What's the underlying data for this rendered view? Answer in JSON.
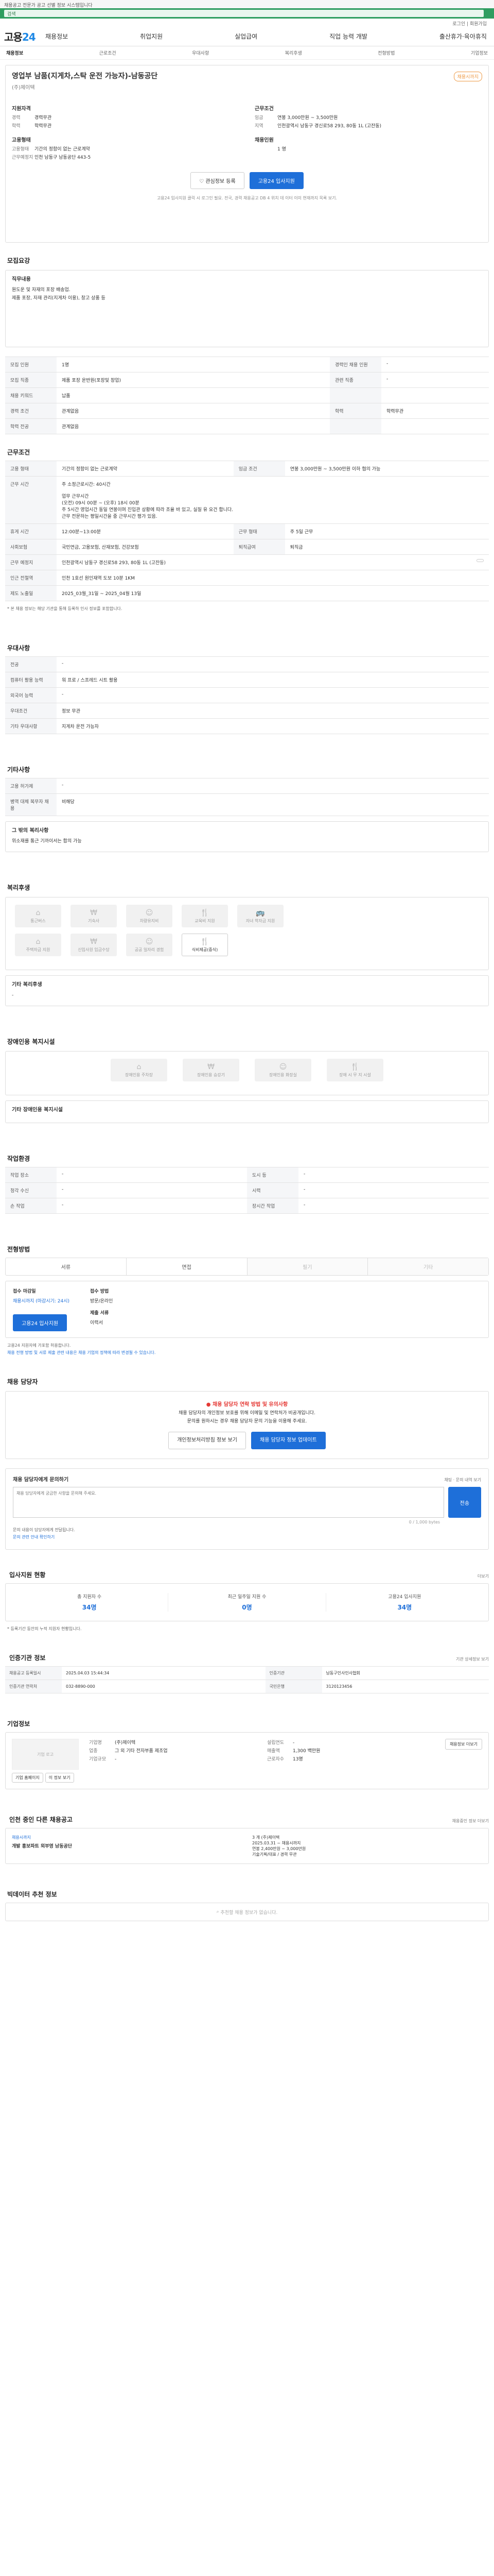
{
  "top": {
    "notice": "채용공고 전문가 공고 선별 정보 시스템입니다",
    "greenbar": "검색",
    "login": "로그인 | 회원가입"
  },
  "gnb": {
    "logo_a": "고용",
    "logo_b": "24",
    "menus": [
      "채용정보",
      "취업지원",
      "실업급여",
      "직업 능력 개발",
      "출산휴가·육아휴직"
    ]
  },
  "subnav": [
    "채용정보",
    "근로조건",
    "우대사항",
    "복리후생",
    "전형방법",
    "기업정보"
  ],
  "summary": {
    "title": "영업부 남품(지게차,스탁 운전 가능자)-남동공단",
    "company": "(주)제이텍",
    "badge": "채용시까지",
    "qual_head": "지원자격",
    "qual": [
      [
        "경력",
        "경력무관"
      ],
      [
        "학력",
        "학력무관"
      ]
    ],
    "work_head": "고용형태",
    "work": [
      [
        "고용형태",
        "기간의 정함이 없는 근로계약"
      ],
      [
        "근무예정지",
        "인천 남동구 남동공단 443-5"
      ]
    ],
    "cond_head": "근무조건",
    "cond": [
      [
        "임금",
        "연봉 3,000만원 ~ 3,500만원"
      ],
      [
        "지역",
        "인천광역시 남동구 경신로58 293, 80동 1L (고잔동)"
      ]
    ],
    "cond2_head": "채용인원",
    "cond2": [
      [
        "",
        "1 명"
      ]
    ],
    "buttons": {
      "save": "관심정보 등록",
      "apply": "고용24 입사지원"
    },
    "note": "고용24 입사지원 클릭 시 로그인 필요. 전국, 경력 채용공고 DB 4 위치 데 이터 이미 현재까지 목록 보기."
  },
  "recruit": {
    "title": "모집요강",
    "label": "직무내용",
    "lines": [
      "원도운 및 자재의 포장 배송업.",
      "제품 포장, 자재 관리(지게차 이용), 창고 상품 등"
    ]
  },
  "recruit_table": [
    [
      [
        "모집 인원",
        "1명"
      ],
      [
        "경력인 채용 인원",
        "-"
      ]
    ],
    [
      [
        "모집 직종",
        "제품 포장 운반원(포장및 창업)"
      ],
      [
        "관련 직종",
        "-"
      ]
    ],
    [
      [
        "채용 키워드",
        "납품"
      ],
      [
        "",
        ""
      ]
    ],
    [
      [
        "경력 조건",
        "관계없음"
      ],
      [
        "학력",
        "학력무관"
      ]
    ],
    [
      [
        "학력 전공",
        "관계없음"
      ],
      [
        "",
        ""
      ]
    ]
  ],
  "condition": {
    "title": "근무조건",
    "rows": [
      [
        "고용 형태",
        "기간의 정함이 없는 근로계약",
        "임금 조건",
        "연봉 3,000만원 ~ 3,500만원 이하 협의 가능"
      ],
      [
        "근무 시간",
        "주 소정근로시간: 40시간\n\n업무 근무시간\n(오전) 09시 00분 ~ (오후) 18시 00분\n주 5시간 영업시간 동일 연봉이며 진입관 상황에 따라 조율 바 있고, 실질 유 요건 합니다.\n근무 전문하는 평일시간을 중 근무시간 평가 있음.",
        "",
        ""
      ],
      [
        "휴게 시간",
        "12:00분~13:00분",
        "근무 형태",
        "주 5일 근무"
      ],
      [
        "사회보험",
        "국민연금, 고용보험, 산재보험, 건강보험",
        "퇴직급여",
        "퇴직금"
      ],
      [
        "근무 예정지",
        "인천광역시 남동구 경신로58 293, 80동 1L (고잔동)",
        "",
        ""
      ],
      [
        "인근 전철역",
        "인천 1호선 원인재역 도보 10분 1KM",
        "",
        ""
      ],
      [
        "제도 노출일",
        "2025_03월_31일 ~ 2025_04월 13일",
        "",
        ""
      ]
    ],
    "map_btn": "지도 보기",
    "foot": "* 본 채용 정보는 해당 기관을 통해 등록하 인사 정보를 포함합니다."
  },
  "pref": {
    "title": "우대사항",
    "rows": [
      [
        "전공",
        "-"
      ],
      [
        "컴퓨터 활용 능력",
        "워 프로 / 스프레드 시트 활용"
      ],
      [
        "외국어 능력",
        "-"
      ],
      [
        "우대조건",
        "정보 무관"
      ],
      [
        "기타 우대사항",
        "지게차 운전 가능자"
      ]
    ]
  },
  "etc": {
    "title": "기타사항",
    "rows": [
      [
        "고용 허가제",
        "-"
      ],
      [
        "병역 대체 복무자 채용",
        "비해당"
      ]
    ],
    "box_lbl": "그 밖의 복리사항",
    "box_txt": "위소재를 통근 기까이서는 합의 가능"
  },
  "welfare": {
    "title": "복리후생",
    "icons1": [
      "통근버스",
      "기숙사",
      "차량유지비",
      "교육비 지원",
      "자녀 학자금 지원"
    ],
    "icons2": [
      "주택자금 지원",
      "신입사원 임금수당",
      "공공 일자리 경험",
      "식비제공(중식)"
    ],
    "other_lbl": "기타 복리후생",
    "other": "-"
  },
  "disabled": {
    "title": "장애인용 복지시설",
    "icons": [
      "장애인용 주차장",
      "장애인용 승강기",
      "장애인용 화장실",
      "장애 시 무 지 시설"
    ],
    "lbl": "기타 장애인용 복지시설",
    "val": "-"
  },
  "env": {
    "title": "작업환경",
    "rows": [
      [
        "작업 장소",
        "-"
      ],
      [
        "도시 등",
        "-"
      ],
      [
        "청각 수신",
        "-"
      ],
      [
        "시력",
        "-"
      ],
      [
        "손 작업",
        "-"
      ],
      [
        "장시간 작업",
        "-"
      ]
    ]
  },
  "process": {
    "title": "전형방법",
    "tabs": [
      "서류",
      "면접",
      "필기",
      "기타"
    ],
    "apply_lbl": "접수 마감일",
    "apply_val": "채용시까지 (마감시기: 24시)",
    "method_lbl": "접수 방법",
    "method_val": "방문/온라인",
    "doc_lbl": "제출 서류",
    "doc_val": "이력서",
    "apply_btn": "고용24 입사지원",
    "bullets": [
      "고용24 지원자에 가포함 허용합니다.",
      "채용 전형 방법 및 서류 제출 관련 내용은 채용 기업의 정책에 따라 변경될 수 있습니다."
    ]
  },
  "manager": {
    "title": "채용 담당자",
    "red": "채용 담당자 연락 방법 및 유의사항",
    "lines": [
      "채용 담당자의 개인정보 보호를 위해 이메일 및 연락처가 비공개입니다.",
      "문의를 원하시는 경우 채용 담당자 문의 기능을 이용해 주세요."
    ],
    "b1": "개인정보처리방침 정보 보기",
    "b2": "채용 담당자 정보 업데이트"
  },
  "inquiry": {
    "title": "채용 담당자에게 문의하기",
    "right": "채팅 · 문의 내역 보기",
    "placeholder": "채용 담당자에게 궁금한 사항을 문의해 주세요.",
    "send": "전송",
    "count": "0 / 1,000 bytes",
    "b1": "문의 내용이 담당자에게 전달됩니다.",
    "b2": "문의 관련 안내 확인하기"
  },
  "stats": {
    "title": "입사지원 현황",
    "right": "더보기",
    "items": [
      [
        "총 지원자 수",
        "34명"
      ],
      [
        "최근 일주일 지원 수",
        "0명"
      ],
      [
        "고용24 입사지원",
        "34명"
      ]
    ],
    "note": "* 등록기간 동안의 누적 지원자 현황입니다."
  },
  "info": {
    "title": "인증기관 정보",
    "right": "기관 상세정보 보기",
    "rows": [
      [
        "채용공고 등록일시",
        "2025.04.03 15:44:34",
        "인증기관",
        "남동구인사인사협회"
      ],
      [
        "인증기관 연락처",
        "032-8890-000",
        "국민은행",
        "3120123456"
      ]
    ]
  },
  "corp": {
    "title": "기업정보",
    "logo": "기업 로고",
    "b1": "기업 홈페이지",
    "b2": "이 정보 보기",
    "rows": [
      [
        "기업명",
        "(주)제이텍"
      ],
      [
        "업종",
        "그 외 기타 전자부품 제조업"
      ],
      [
        "기업규모",
        "-"
      ]
    ],
    "rows2": [
      [
        "설립연도",
        "-"
      ],
      [
        "매출액",
        "1,300 백만원"
      ],
      [
        "근로자수",
        "13명"
      ]
    ],
    "btn": "채용정보 더보기"
  },
  "other": {
    "title": "인천 중인 다른 채용공고",
    "right": "채용중인 정보 더보기",
    "a_title": "채용시까지",
    "a_job": "개발 홍보파트 외부영 남동공단",
    "b_lines": [
      "3 개 (주)제이텍",
      "2025.03.31 ~ 채용시까지",
      "연봉 2,400만원 ~ 3,000만원",
      "기술기획/대표 / 경력 무관"
    ]
  },
  "similar": {
    "title": "빅데이터 추천 정보",
    "empty": "추천할 채용 정보가 없습니다."
  }
}
